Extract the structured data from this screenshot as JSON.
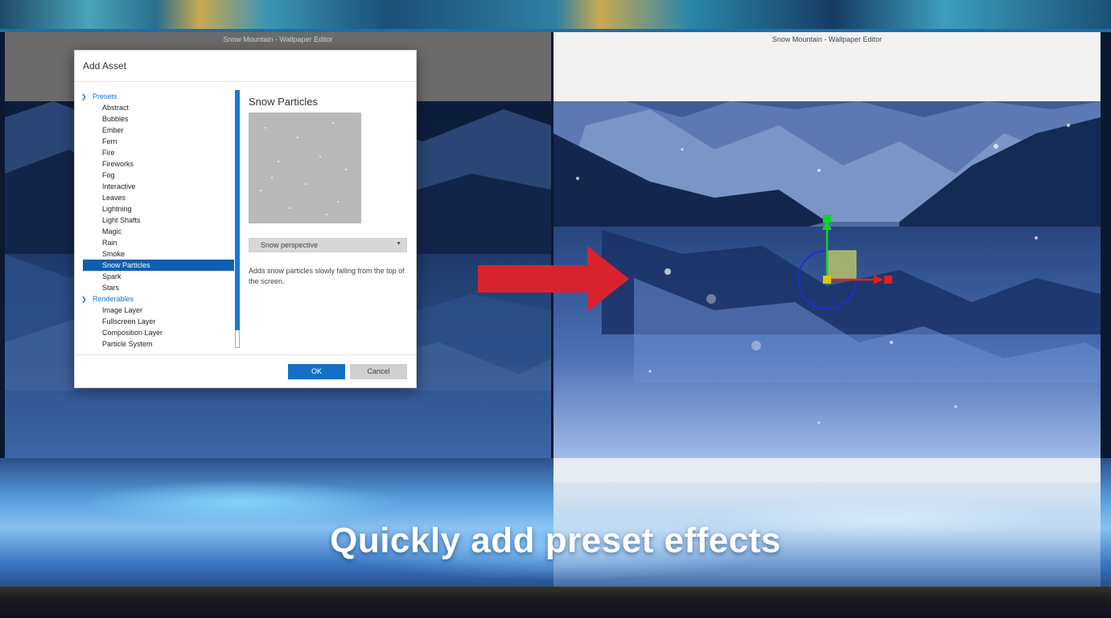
{
  "editor": {
    "window_title": "Snow Mountain - Wallpaper Editor"
  },
  "dialog": {
    "title": "Add Asset",
    "tree": {
      "presets_label": "Presets",
      "preset_items": [
        "Abstract",
        "Bubbles",
        "Ember",
        "Fern",
        "Fire",
        "Fireworks",
        "Fog",
        "Interactive",
        "Leaves",
        "Lightning",
        "Light Shafts",
        "Magic",
        "Rain",
        "Smoke",
        "Snow Particles",
        "Spark",
        "Stars"
      ],
      "selected_item": "Snow Particles",
      "renderables_label": "Renderables",
      "renderable_items": [
        "Image Layer",
        "Fullscreen Layer",
        "Composition Layer",
        "Particle System"
      ]
    },
    "detail": {
      "title": "Snow Particles",
      "variant_select": "Snow perspective",
      "description": "Adds snow particles slowly falling from the top of the screen."
    },
    "buttons": {
      "ok": "OK",
      "cancel": "Cancel"
    }
  },
  "caption": "Quickly add preset effects",
  "colors": {
    "accent_blue": "#1270c9",
    "arrow_red": "#d8232f",
    "gizmo_y": "#12d12f",
    "gizmo_x": "#e02020",
    "gizmo_center": "#e8c400",
    "gizmo_ring": "#1a2fd8"
  },
  "icons": [
    "chevron-down-icon",
    "dropdown-caret-icon",
    "right-arrow-icon",
    "transform-gizmo-icon"
  ]
}
